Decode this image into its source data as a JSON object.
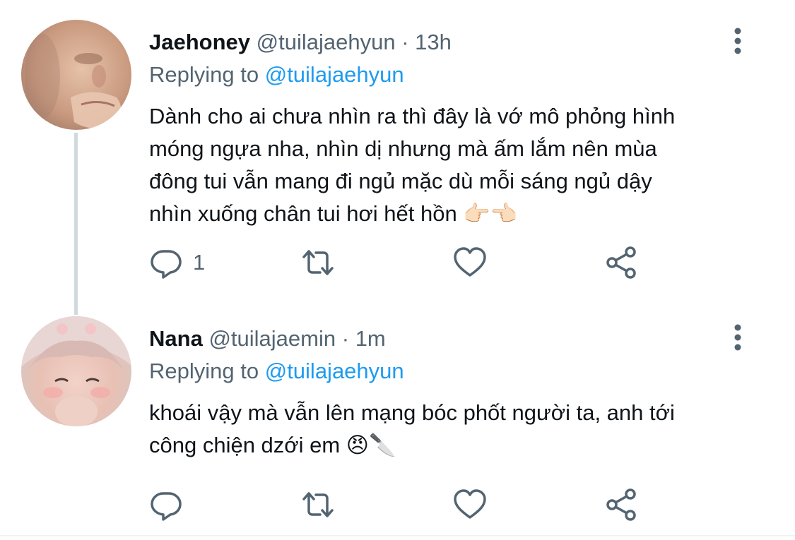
{
  "tweets": [
    {
      "display_name": "Jaehoney",
      "handle": "@tuilajaehyun",
      "separator": "·",
      "time": "13h",
      "replying_prefix": "Replying to",
      "replying_to": "@tuilajaehyun",
      "text_lines": [
        "Dành cho ai chưa nhìn ra thì đây là vớ mô phỏng hình",
        "móng ngựa nha, nhìn dị nhưng mà ấm lắm nên mùa",
        "đông tui vẫn mang đi ngủ mặc dù mỗi sáng ngủ dậy",
        "nhìn xuống chân tui hơi hết hồn 👉🏻👈🏻"
      ],
      "reply_count": "1",
      "retweet_count": "",
      "like_count": ""
    },
    {
      "display_name": "Nana",
      "handle": "@tuilajaemin",
      "separator": "·",
      "time": "1m",
      "replying_prefix": "Replying to",
      "replying_to": "@tuilajaehyun",
      "text_lines": [
        "khoái vậy mà vẫn lên mạng bóc phốt người ta, anh tới",
        "công chiện dzới em 😠🔪"
      ],
      "reply_count": "",
      "retweet_count": "",
      "like_count": ""
    }
  ],
  "icons": {
    "reply": "reply-icon",
    "retweet": "retweet-icon",
    "like": "heart-icon",
    "share": "share-icon",
    "more": "more-vertical-icon"
  },
  "colors": {
    "text": "#0f1419",
    "secondary": "#536471",
    "link": "#1d9bf0",
    "thread_line": "#cfd9de"
  }
}
